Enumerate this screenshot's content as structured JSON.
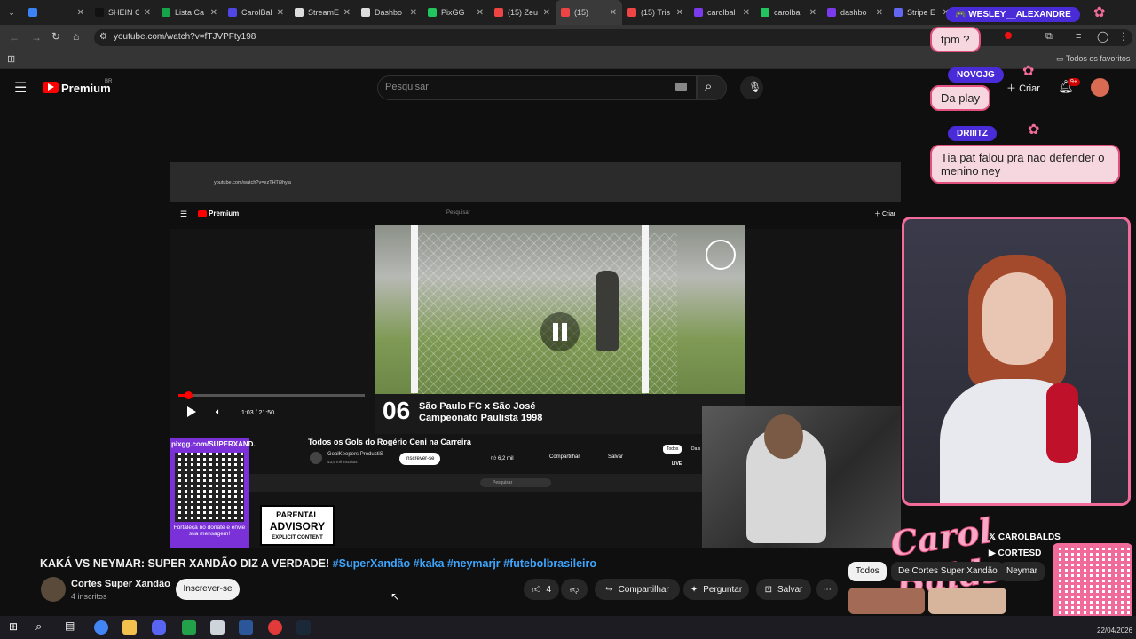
{
  "browser": {
    "tabs": [
      {
        "label": "",
        "color": "#3b82f6"
      },
      {
        "label": "SHEIN C",
        "color": "#111111"
      },
      {
        "label": "Lista Ca",
        "color": "#16a34a"
      },
      {
        "label": "CarolBal",
        "color": "#4f46e5"
      },
      {
        "label": "StreamE",
        "color": "#dddddd"
      },
      {
        "label": "Dashbo",
        "color": "#dddddd"
      },
      {
        "label": "PixGG",
        "color": "#22c55e"
      },
      {
        "label": "(15) Zeu",
        "color": "#ef4444"
      },
      {
        "label": "(15)",
        "color": "#ef4444",
        "active": true
      },
      {
        "label": "(15) Tris",
        "color": "#ef4444"
      },
      {
        "label": "carolbal",
        "color": "#7c3aed"
      },
      {
        "label": "carolbal",
        "color": "#22c55e"
      },
      {
        "label": "dashbo",
        "color": "#7c3aed"
      },
      {
        "label": "Stripe E",
        "color": "#6366f1"
      }
    ],
    "url": "youtube.com/watch?v=fTJVPFty198",
    "bookmarks_label": "Todos os favoritos"
  },
  "youtube": {
    "logo": "Premium",
    "region": "BR",
    "search_placeholder": "Pesquisar",
    "create_label": "Criar",
    "notif_count": "9+"
  },
  "video": {
    "inner_url": "youtube.com/watch?v=ezTHTi9hy.a",
    "inner_logo": "Premium",
    "inner_search": "Pesquisar",
    "inner_create": "Criar",
    "time": "1:03 / 21:50",
    "progress": 0.05,
    "caption_number": "06",
    "caption_line1": "São Paulo FC x São José",
    "caption_line2": "Campeonato Paulista 1998",
    "pix_url": "pixgg.com/SUPERXAND.",
    "pix_message": "Fortaleça no donate e envie sua mensagem!",
    "inner_title": "Todos os Gols do Rogério Ceni na Carreira",
    "inner_channel": "GoalKeepers ProductiS",
    "inner_subs": "43,5 mil inscritos",
    "inner_subscribe": "Inscrever-se",
    "inner_likes": "6,2 mil",
    "inner_share": "Compartilhar",
    "inner_save": "Salvar",
    "inner_chip_all": "Todos",
    "inner_chip_2": "Da s",
    "inner_taskbar_search": "Pesquisar",
    "inner_live": "LIVE",
    "advisory_line1": "PARENTAL",
    "advisory_line2": "ADVISORY",
    "advisory_line3": "EXPLICIT CONTENT"
  },
  "overlay": {
    "chat": [
      {
        "user": "WESLEY__ALEXANDRE",
        "message": "tpm ?"
      },
      {
        "user": "NOVOJG",
        "message": "Da play"
      },
      {
        "user": "DRIIITZ",
        "message": "Tia pat falou pra nao defender o menino ney"
      }
    ],
    "brand": "Carol Balds",
    "social_1": "CAROLBALDS",
    "social_2": "CORTESD"
  },
  "meta": {
    "title_main": "KAKÁ VS NEYMAR: SUPER XANDÃO DIZ A VERDADE!",
    "title_tags": "#SuperXandão #kaka #neymarjr #futebolbrasileiro",
    "channel": "Cortes Super Xandão",
    "subscribers": "4 inscritos",
    "subscribe": "Inscrever-se",
    "likes": "4",
    "share": "Compartilhar",
    "ask": "Perguntar",
    "save": "Salvar",
    "chips": [
      "Todos",
      "De Cortes Super Xandão",
      "Neymar"
    ]
  },
  "taskbar": {
    "date": "22/04/2026"
  }
}
